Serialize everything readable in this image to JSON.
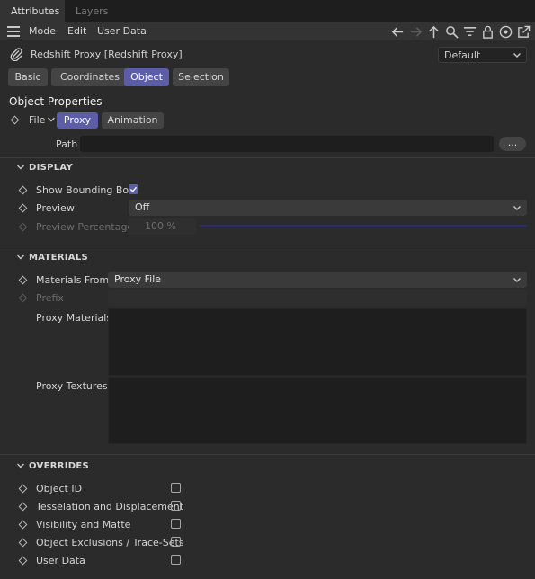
{
  "tabs": [
    {
      "label": "Attributes",
      "active": true
    },
    {
      "label": "Layers",
      "active": false
    }
  ],
  "menu": {
    "items": [
      "Mode",
      "Edit",
      "User Data"
    ]
  },
  "toolbar_icons": [
    "arrow-left-icon",
    "arrow-right-icon",
    "arrow-up-icon",
    "search-icon",
    "filter-icon",
    "lock-icon",
    "target-icon",
    "new-window-icon"
  ],
  "object": {
    "title": "Redshift Proxy [Redshift Proxy]",
    "preset": "Default"
  },
  "page_tabs": [
    {
      "label": "Basic",
      "selected": false
    },
    {
      "label": "Coordinates",
      "selected": false
    },
    {
      "label": "Object",
      "selected": true
    },
    {
      "label": "Selection",
      "selected": false
    }
  ],
  "section_title": "Object Properties",
  "file": {
    "label": "File",
    "subtabs": [
      {
        "label": "Proxy",
        "selected": true
      },
      {
        "label": "Animation",
        "selected": false
      }
    ],
    "path_label": "Path",
    "path_value": "",
    "browse_label": "..."
  },
  "display": {
    "header": "DISPLAY",
    "show_bbox_label": "Show Bounding Box",
    "show_bbox_checked": true,
    "preview_label": "Preview",
    "preview_value": "Off",
    "preview_pct_label": "Preview Percentage",
    "preview_pct_value": "100 %"
  },
  "materials": {
    "header": "MATERIALS",
    "from_label": "Materials From",
    "from_value": "Proxy File",
    "prefix_label": "Prefix",
    "proxy_materials_label": "Proxy Materials",
    "proxy_textures_label": "Proxy Textures"
  },
  "overrides": {
    "header": "OVERRIDES",
    "items": [
      {
        "label": "Object ID",
        "checked": false
      },
      {
        "label": "Tesselation and Displacement",
        "checked": false
      },
      {
        "label": "Visibility and Matte",
        "checked": false
      },
      {
        "label": "Object Exclusions / Trace-Sets",
        "checked": false
      },
      {
        "label": "User Data",
        "checked": false
      }
    ]
  },
  "colors": {
    "accent": "#5b5ea6",
    "background": "#2b2b2b",
    "field": "#1e1e1e"
  }
}
